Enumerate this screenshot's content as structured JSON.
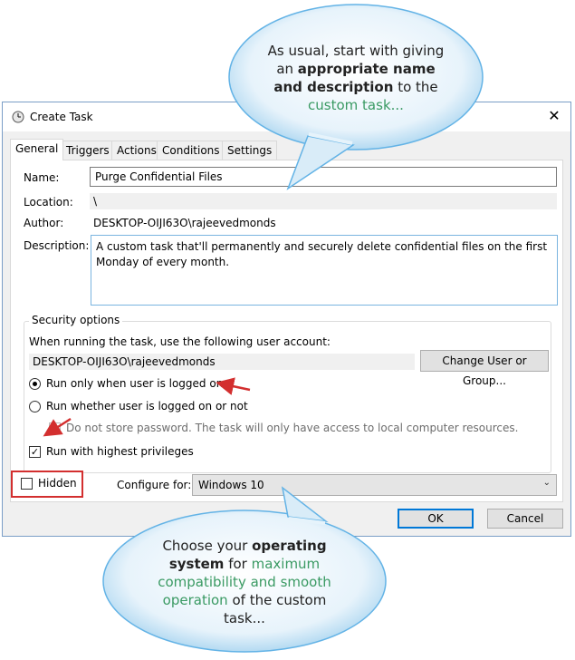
{
  "window": {
    "title": "Create Task",
    "close": "✕"
  },
  "tabs": [
    "General",
    "Triggers",
    "Actions",
    "Conditions",
    "Settings"
  ],
  "general": {
    "name_label": "Name:",
    "name_value": "Purge Confidential Files",
    "location_label": "Location:",
    "location_value": "\\",
    "author_label": "Author:",
    "author_value": "DESKTOP-OIJI63O\\rajeevedmonds",
    "description_label": "Description:",
    "description_value": "A custom task that'll permanently and securely delete confidential files on the first Monday of every month."
  },
  "security": {
    "title": "Security options",
    "account_prompt": "When running the task, use the following user account:",
    "account_value": "DESKTOP-OIJI63O\\rajeevedmonds",
    "change_button": "Change User or Group...",
    "radio_logged_on": "Run only when user is logged on",
    "radio_whether": "Run whether user is logged on or not",
    "no_store_password": "Do not store password.  The task will only have access to local computer resources.",
    "highest_privileges": "Run with highest privileges"
  },
  "bottom": {
    "hidden_label": "Hidden",
    "configure_label": "Configure for:",
    "configure_value": "Windows 10",
    "ok": "OK",
    "cancel": "Cancel"
  },
  "callout_top": {
    "l1": "As usual, start with giving",
    "l2a": "an ",
    "l2b": "appropriate name",
    "l3a": "and description",
    "l3b": " to the",
    "l4": "custom task..."
  },
  "callout_bottom": {
    "l1a": "Choose your ",
    "l1b": "operating",
    "l2a": "system",
    "l2b": " for ",
    "l2c": "maximum",
    "l3": "compatibility and smooth",
    "l4a": "operation",
    "l4b": " of the custom",
    "l5": "task..."
  },
  "colors": {
    "accent": "#0078d7",
    "callout_green": "#3a9a63",
    "arrow_red": "#d32f2f"
  }
}
